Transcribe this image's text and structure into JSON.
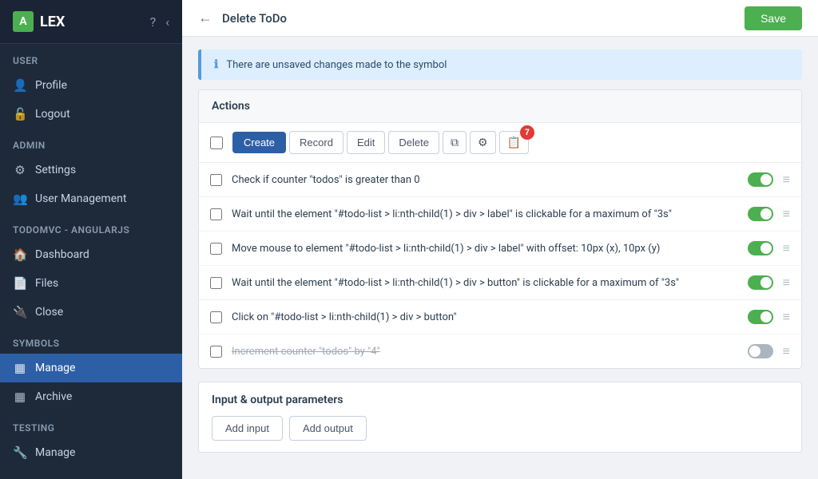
{
  "app": {
    "logo_letter": "A",
    "logo_text": "LEX"
  },
  "header_icons": {
    "help": "?",
    "collapse": "‹"
  },
  "sidebar": {
    "sections": [
      {
        "title": "User",
        "items": [
          {
            "id": "profile",
            "label": "Profile",
            "icon": "👤"
          },
          {
            "id": "logout",
            "label": "Logout",
            "icon": "🔓"
          }
        ]
      },
      {
        "title": "Admin",
        "items": [
          {
            "id": "settings",
            "label": "Settings",
            "icon": "⚙"
          },
          {
            "id": "user-management",
            "label": "User Management",
            "icon": "👥"
          }
        ]
      },
      {
        "title": "TodoMVC - Angularjs",
        "items": [
          {
            "id": "dashboard",
            "label": "Dashboard",
            "icon": "🏠"
          },
          {
            "id": "files",
            "label": "Files",
            "icon": "📄"
          },
          {
            "id": "close",
            "label": "Close",
            "icon": "🔌"
          }
        ]
      },
      {
        "title": "Symbols",
        "items": [
          {
            "id": "manage",
            "label": "Manage",
            "icon": "▦",
            "active": true
          },
          {
            "id": "archive",
            "label": "Archive",
            "icon": "▦"
          }
        ]
      },
      {
        "title": "Testing",
        "items": [
          {
            "id": "testing-manage",
            "label": "Manage",
            "icon": "🔧"
          }
        ]
      }
    ]
  },
  "topbar": {
    "back_label": "←",
    "title": "Delete ToDo",
    "save_label": "Save"
  },
  "info_banner": {
    "text": "There are unsaved changes made to the symbol"
  },
  "actions_section": {
    "title": "Actions",
    "toolbar_buttons": {
      "create": "Create",
      "record": "Record",
      "edit": "Edit",
      "delete": "Delete"
    },
    "badge_count": "7",
    "rows": [
      {
        "id": "row1",
        "text": "Check if counter \"todos\" is greater than 0",
        "enabled": true,
        "strikethrough": false
      },
      {
        "id": "row2",
        "text": "Wait until the element \"#todo-list > li:nth-child(1) > div > label\" is clickable for a maximum of \"3s\"",
        "enabled": true,
        "strikethrough": false
      },
      {
        "id": "row3",
        "text": "Move mouse to element \"#todo-list > li:nth-child(1) > div > label\" with offset: 10px (x), 10px (y)",
        "enabled": true,
        "strikethrough": false
      },
      {
        "id": "row4",
        "text": "Wait until the element \"#todo-list > li:nth-child(1) > div > button\" is clickable for a maximum of \"3s\"",
        "enabled": true,
        "strikethrough": false
      },
      {
        "id": "row5",
        "text": "Click on \"#todo-list > li:nth-child(1) > div > button\"",
        "enabled": true,
        "strikethrough": false
      },
      {
        "id": "row6",
        "text": "Increment counter \"todos\" by \"4\"",
        "enabled": false,
        "strikethrough": true
      }
    ]
  },
  "io_section": {
    "title": "Input & output parameters",
    "add_input_label": "Add input",
    "add_output_label": "Add output"
  }
}
